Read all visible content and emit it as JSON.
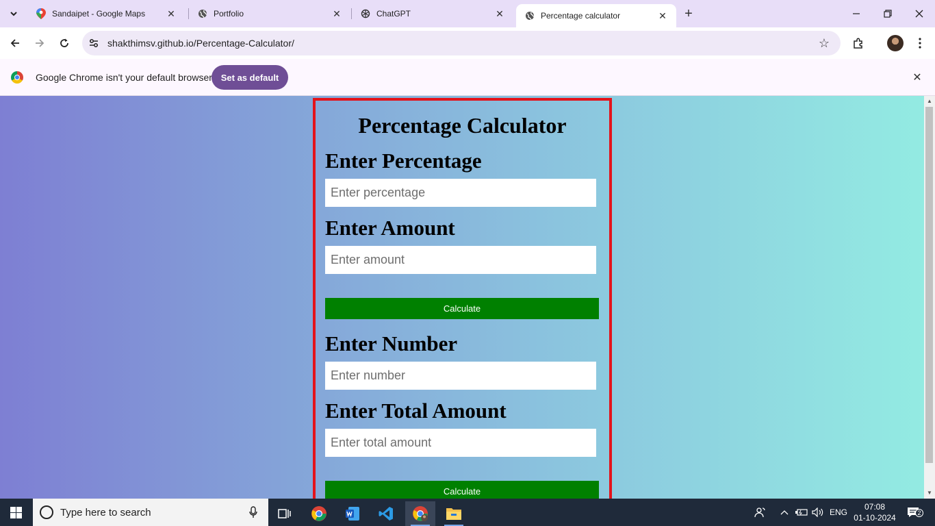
{
  "browser": {
    "tabs": [
      {
        "label": "Sandaipet - Google Maps",
        "icon": "google-maps-icon",
        "active": false
      },
      {
        "label": "Portfolio",
        "icon": "globe-icon",
        "active": false
      },
      {
        "label": "ChatGPT",
        "icon": "chatgpt-icon",
        "active": false
      },
      {
        "label": "Percentage calculator",
        "icon": "globe-icon",
        "active": true
      }
    ],
    "address": "shakthimsv.github.io/Percentage-Calculator/",
    "infobar": {
      "message": "Google Chrome isn't your default browser",
      "button": "Set as default"
    }
  },
  "page": {
    "title": "Percentage Calculator",
    "sections": [
      {
        "fields": [
          {
            "label": "Enter Percentage",
            "placeholder": "Enter percentage",
            "value": ""
          },
          {
            "label": "Enter Amount",
            "placeholder": "Enter amount",
            "value": ""
          }
        ],
        "button": "Calculate"
      },
      {
        "fields": [
          {
            "label": "Enter Number",
            "placeholder": "Enter number",
            "value": ""
          },
          {
            "label": "Enter Total Amount",
            "placeholder": "Enter total amount",
            "value": ""
          }
        ],
        "button": "Calculate"
      }
    ],
    "colors": {
      "border": "#e3131b",
      "button": "#008000",
      "gradient_start": "#7e7fd3",
      "gradient_end": "#93ebe2"
    }
  },
  "taskbar": {
    "search_placeholder": "Type here to search",
    "apps": [
      "task-view-icon",
      "chrome-icon",
      "word-icon",
      "vscode-icon",
      "chrome-profile-icon",
      "file-explorer-icon"
    ],
    "language": "ENG",
    "time": "07:08",
    "date": "01-10-2024",
    "notification_count": "2"
  }
}
